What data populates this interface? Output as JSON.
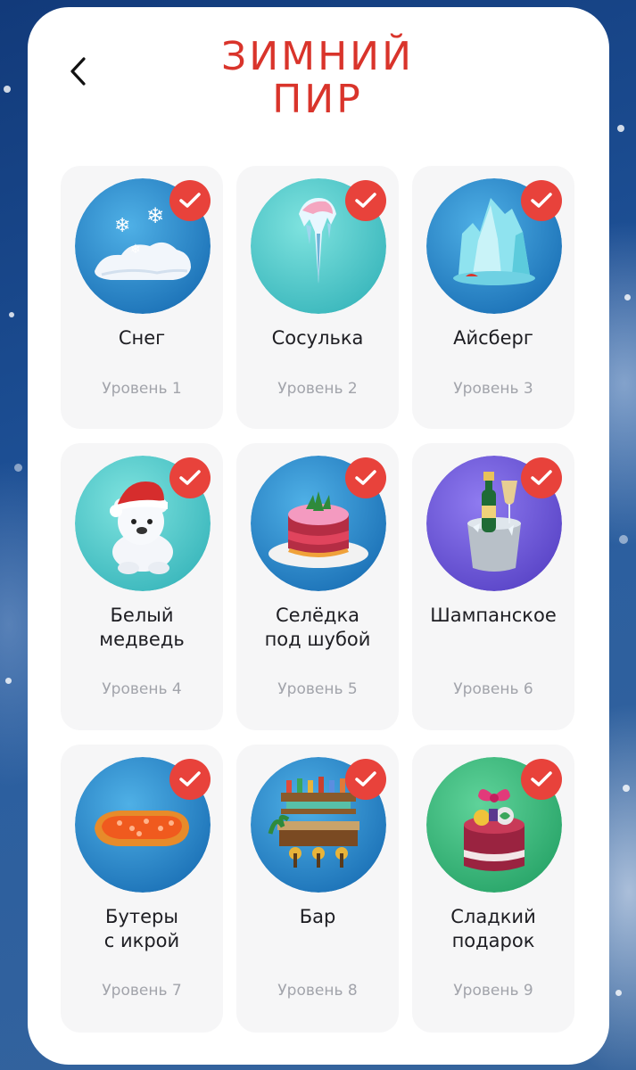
{
  "header": {
    "title_line1": "ЗИМНИЙ",
    "title_line2": "ПИР"
  },
  "colors": {
    "accent": "#d9342b",
    "check": "#e8423b",
    "tile_bg": "#f6f6f7",
    "level_text": "#a2a4ab"
  },
  "levels": [
    {
      "name": "Снег",
      "level": "Уровень 1",
      "icon": "snow-pile-icon",
      "completed": true
    },
    {
      "name": "Сосулька",
      "level": "Уровень 2",
      "icon": "icicle-icon",
      "completed": true
    },
    {
      "name": "Айсберг",
      "level": "Уровень 3",
      "icon": "iceberg-icon",
      "completed": true
    },
    {
      "name": "Белый\nмедведь",
      "level": "Уровень 4",
      "icon": "polar-bear-icon",
      "completed": true
    },
    {
      "name": "Селёдка\nпод шубой",
      "level": "Уровень 5",
      "icon": "herring-salad-icon",
      "completed": true
    },
    {
      "name": "Шампанское",
      "level": "Уровень 6",
      "icon": "champagne-icon",
      "completed": true
    },
    {
      "name": "Бутеры\nс икрой",
      "level": "Уровень 7",
      "icon": "caviar-sandwich-icon",
      "completed": true
    },
    {
      "name": "Бар",
      "level": "Уровень 8",
      "icon": "bar-counter-icon",
      "completed": true
    },
    {
      "name": "Сладкий\nподарок",
      "level": "Уровень 9",
      "icon": "sweet-gift-icon",
      "completed": true
    }
  ]
}
